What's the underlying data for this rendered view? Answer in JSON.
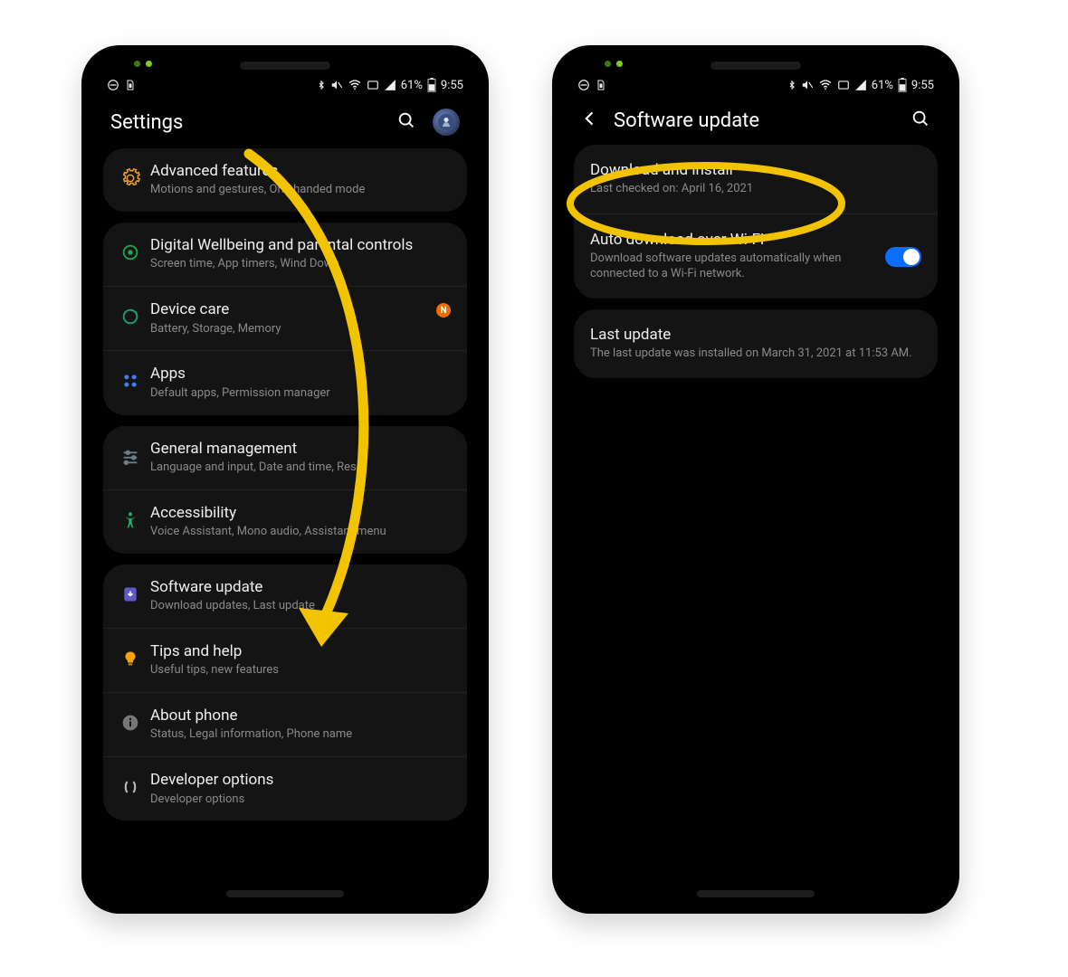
{
  "status": {
    "battery_text": "61%",
    "time": "9:55"
  },
  "left_screen": {
    "title": "Settings",
    "groups": [
      {
        "items": [
          {
            "icon": "gear-icon",
            "color": "#f0a020",
            "title": "Advanced features",
            "sub": "Motions and gestures, One-handed mode"
          }
        ]
      },
      {
        "items": [
          {
            "icon": "wellbeing-icon",
            "color": "#1aa54a",
            "title": "Digital Wellbeing and parental controls",
            "sub": "Screen time, App timers, Wind Down"
          },
          {
            "icon": "devicecare-icon",
            "color": "#18a36a",
            "title": "Device care",
            "sub": "Battery, Storage, Memory",
            "badge": "N"
          },
          {
            "icon": "apps-icon",
            "color": "#3f7ef0",
            "title": "Apps",
            "sub": "Default apps, Permission manager"
          }
        ]
      },
      {
        "items": [
          {
            "icon": "sliders-icon",
            "color": "#6b7f8a",
            "title": "General management",
            "sub": "Language and input, Date and time, Reset"
          },
          {
            "icon": "accessibility-icon",
            "color": "#23b26e",
            "title": "Accessibility",
            "sub": "Voice Assistant, Mono audio, Assistant menu"
          }
        ]
      },
      {
        "items": [
          {
            "icon": "update-icon",
            "color": "#5e59c7",
            "title": "Software update",
            "sub": "Download updates, Last update"
          },
          {
            "icon": "tips-icon",
            "color": "#f4a300",
            "title": "Tips and help",
            "sub": "Useful tips, new features"
          },
          {
            "icon": "info-icon",
            "color": "#777",
            "title": "About phone",
            "sub": "Status, Legal information, Phone name"
          },
          {
            "icon": "dev-icon",
            "color": "#bbb",
            "title": "Developer options",
            "sub": "Developer options"
          }
        ]
      }
    ]
  },
  "right_screen": {
    "title": "Software update",
    "items": [
      {
        "title": "Download and install",
        "sub": "Last checked on: April 16, 2021"
      },
      {
        "title": "Auto download over Wi-Fi",
        "sub": "Download software updates automatically when connected to a Wi-Fi network.",
        "toggle": true
      }
    ],
    "last_update": {
      "title": "Last update",
      "sub": "The last update was installed on March 31, 2021 at 11:53 AM."
    }
  },
  "annotations": {
    "arrow_color": "#f2c400",
    "ellipse_color": "#f2c400"
  }
}
